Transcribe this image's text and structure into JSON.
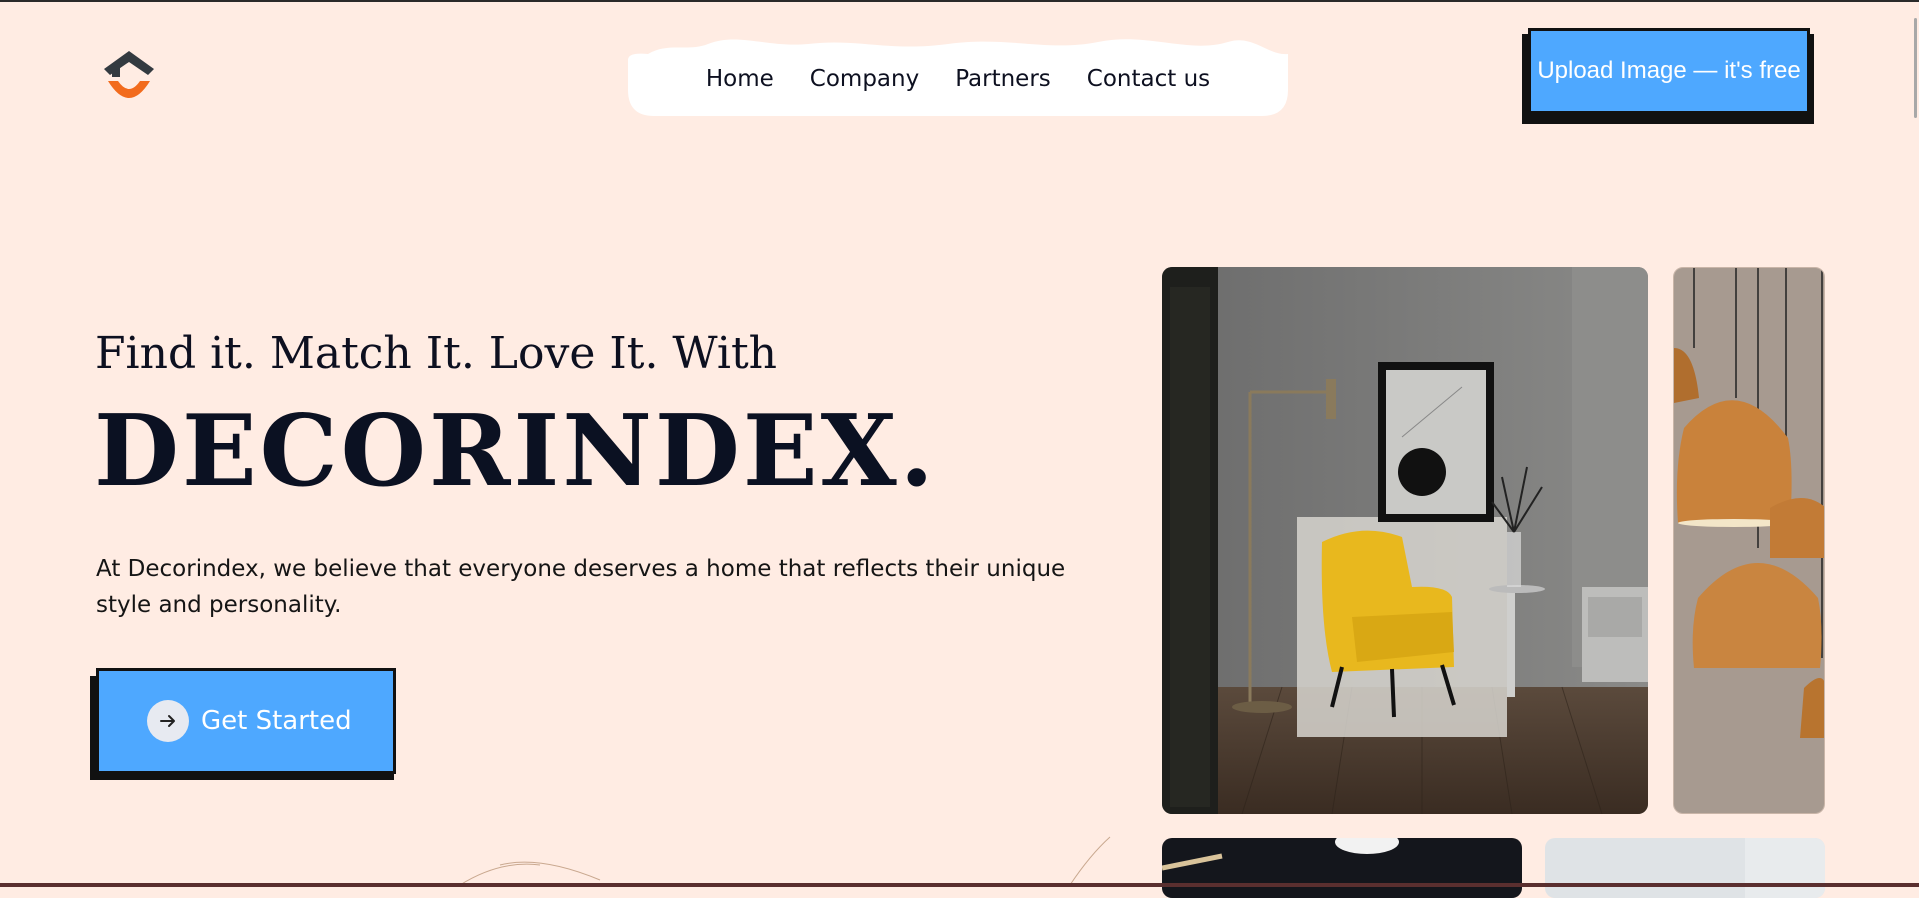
{
  "nav": {
    "logo_icon": "house-smile-logo-icon",
    "items": [
      {
        "label": "Home"
      },
      {
        "label": "Company"
      },
      {
        "label": "Partners"
      },
      {
        "label": "Contact us"
      }
    ]
  },
  "upload": {
    "label": "Upload Image — it's free"
  },
  "hero": {
    "tagline": "Find it. Match It. Love It. With",
    "brand": "DECORINDEX.",
    "description": "At Decorindex, we believe that everyone deserves a home that reflects their unique style and personality.",
    "cta_label": "Get Started",
    "cta_icon": "arrow-right-icon"
  },
  "colors": {
    "background": "#ffece3",
    "accent": "#4ea8ff",
    "dark": "#0b1122",
    "logo_orange": "#f26b1d",
    "logo_dark": "#333a40"
  }
}
